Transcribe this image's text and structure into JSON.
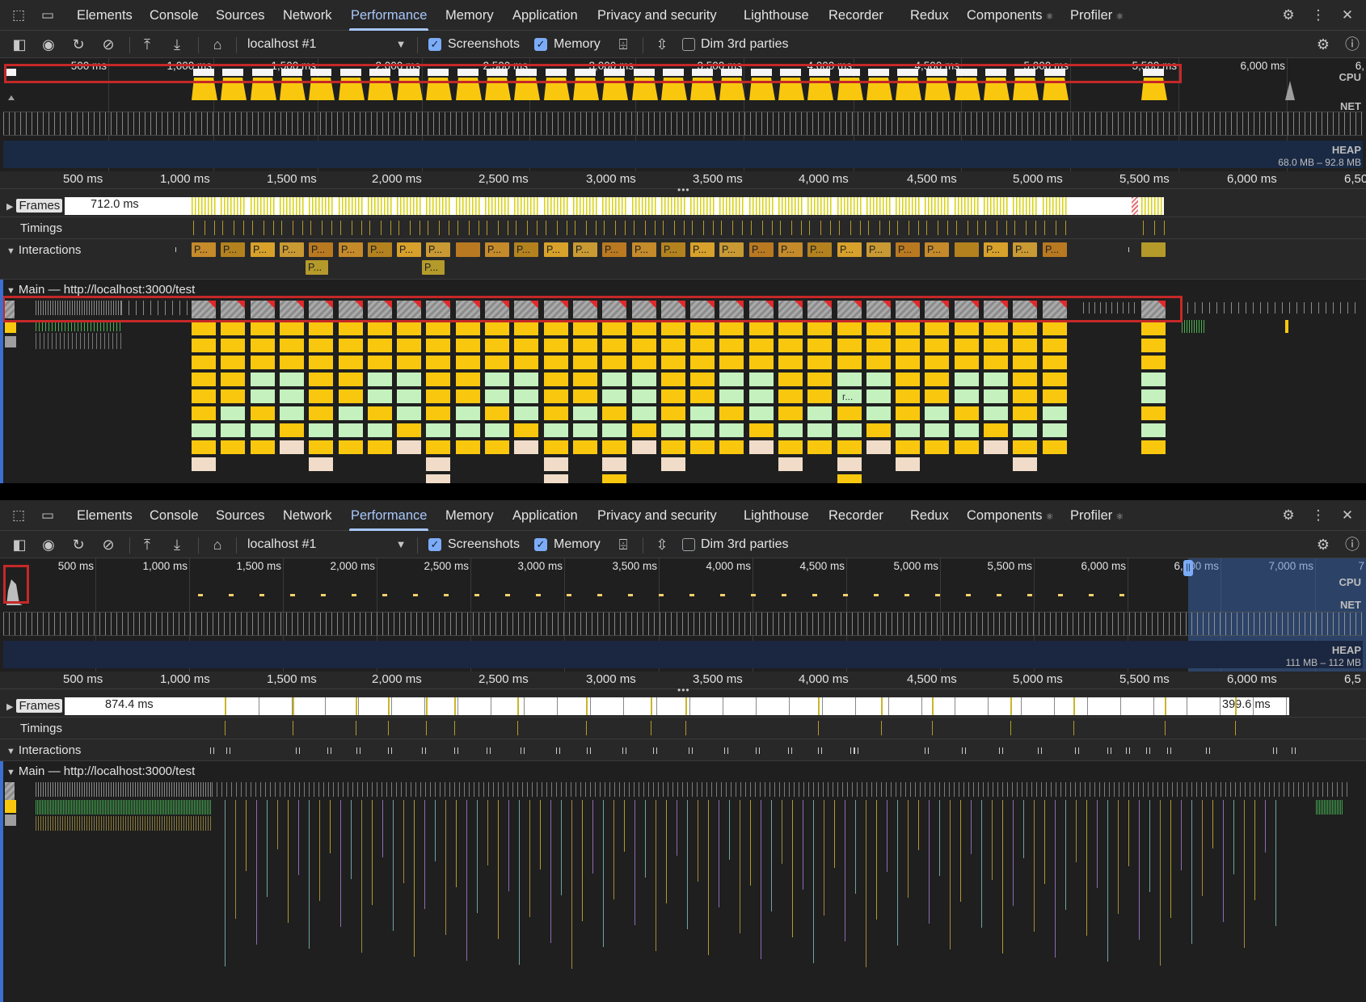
{
  "tabs": [
    "Elements",
    "Console",
    "Sources",
    "Network",
    "Performance",
    "Memory",
    "Application",
    "Privacy and security",
    "Lighthouse",
    "Recorder",
    "Redux",
    "Components",
    "Profiler"
  ],
  "react_glyph": "⚛",
  "toolbar": {
    "target": "localhost #1",
    "screenshots_label": "Screenshots",
    "screenshots_checked": true,
    "memory_label": "Memory",
    "memory_checked": true,
    "dim_label": "Dim 3rd parties",
    "dim_checked": false
  },
  "icons": {
    "inspect": "inspect-element-icon",
    "device": "device-toolbar-icon",
    "sidebar": "sidebar-toggle-icon",
    "record": "record-icon",
    "reload": "reload-record-icon",
    "clear": "clear-icon",
    "upload": "load-profile-icon",
    "download": "save-profile-icon",
    "home": "home-icon",
    "gc": "garbage-collect-icon",
    "collapse": "collapse-tracks-icon",
    "settings": "gear-icon",
    "more": "more-vertical-icon",
    "close": "close-icon",
    "help": "help-icon",
    "capture_settings": "capture-settings-icon"
  },
  "track_labels": {
    "frames": "Frames",
    "timings": "Timings",
    "interactions": "Interactions",
    "main": "Main — http://localhost:3000/test"
  },
  "overview_side": {
    "cpu": "CPU",
    "net": "NET",
    "heap": "HEAP"
  },
  "top": {
    "overview_ticks": [
      "500 ms",
      "1,000 ms",
      "1,500 ms",
      "2,000 ms",
      "2,500 ms",
      "3,000 ms",
      "3,500 ms",
      "4,000 ms",
      "4,500 ms",
      "5,000 ms",
      "5,500 ms",
      "6,000 ms",
      "6,"
    ],
    "ruler_ticks": [
      "500 ms",
      "1,000 ms",
      "1,500 ms",
      "2,000 ms",
      "2,500 ms",
      "3,000 ms",
      "3,500 ms",
      "4,000 ms",
      "4,500 ms",
      "5,000 ms",
      "5,500 ms",
      "6,000 ms",
      "6,50"
    ],
    "heap_range": "68.0 MB – 92.8 MB",
    "frames_value": "712.0 ms",
    "interaction_label": "P...",
    "flame_label": "r..."
  },
  "bottom": {
    "overview_ticks": [
      "500 ms",
      "1,000 ms",
      "1,500 ms",
      "2,000 ms",
      "2,500 ms",
      "3,000 ms",
      "3,500 ms",
      "4,000 ms",
      "4,500 ms",
      "5,000 ms",
      "5,500 ms",
      "6,000 ms",
      "6,000 ms",
      "7,000 ms",
      "7"
    ],
    "ruler_ticks": [
      "500 ms",
      "1,000 ms",
      "1,500 ms",
      "2,000 ms",
      "2,500 ms",
      "3,000 ms",
      "3,500 ms",
      "4,000 ms",
      "4,500 ms",
      "5,000 ms",
      "5,500 ms",
      "6,000 ms",
      "6,5"
    ],
    "heap_range": "111 MB – 112 MB",
    "frames_value_left": "874.4 ms",
    "frames_value_right": "399.6 ms"
  },
  "colors": {
    "scripting": "#f9c80e",
    "rendering": "#c4f1be",
    "painting": "#f0dcc8",
    "system": "#9e9e9e",
    "long_task_flag": "#e0292b",
    "annotation": "#c62828",
    "accent": "#a8c7fa"
  }
}
